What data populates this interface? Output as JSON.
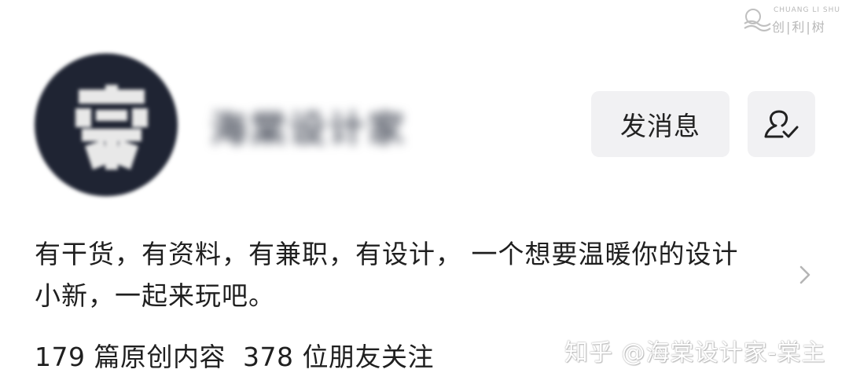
{
  "watermark_logo": {
    "small_text": "CHUANG LI SHU",
    "big_text": "创|利|树"
  },
  "profile": {
    "name": "海棠设计家",
    "bio_line1": "有干货，有资料，有兼职，有设计， 一个想要温暖你的设计",
    "bio_line2": "小新，一起来玩吧。",
    "stats_articles": "179 篇原创内容",
    "stats_followers": "378 位朋友关注"
  },
  "actions": {
    "message_label": "发消息",
    "follow_icon": "user-check-icon"
  },
  "zhihu_watermark": "知乎 @海棠设计家-棠主",
  "colors": {
    "avatar_bg": "#1f2433",
    "button_bg": "#f1f1f3",
    "text": "#1f1f1f"
  }
}
